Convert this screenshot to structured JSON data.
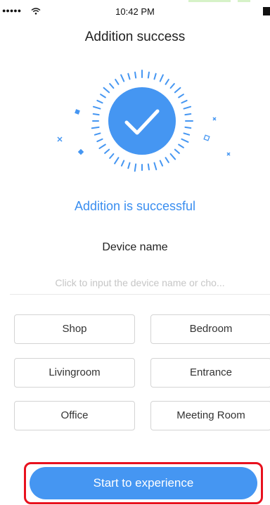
{
  "status_bar": {
    "signal": "●●●●●",
    "time": "10:42 PM"
  },
  "header": {
    "title": "Addition success"
  },
  "success_message": "Addition is successful",
  "device": {
    "label": "Device name",
    "placeholder": "Click to input the device name or cho...",
    "value": "",
    "options": [
      "Shop",
      "Bedroom",
      "Livingroom",
      "Entrance",
      "Office",
      "Meeting Room"
    ]
  },
  "cta": {
    "label": "Start to experience"
  },
  "colors": {
    "accent": "#4596f2",
    "success_text": "#3a8ef0",
    "highlight_border": "#e8111e"
  }
}
